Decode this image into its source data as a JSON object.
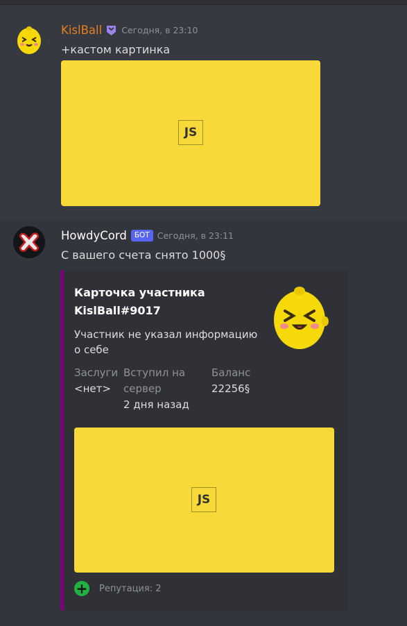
{
  "messages": [
    {
      "author": "KislBall",
      "author_color": "#e67e22",
      "badge_icon": "nitro-badge-icon",
      "timestamp": "Сегодня, в 23:10",
      "text": "+кастом картинка",
      "image": {
        "label": "JS",
        "background": "#f7da3a"
      }
    },
    {
      "author": "HowdyCord",
      "author_color": "#ffffff",
      "bot_tag": "БОТ",
      "timestamp": "Сегодня, в 23:11",
      "text": "С вашего счета снято 1000§",
      "embed": {
        "color": "#800080",
        "title_line1": "Карточка участника",
        "title_line2": "KislBall#9017",
        "description_line1": "Участник не указал информацию",
        "description_line2": "о себе",
        "fields": [
          {
            "name": "Заслуги",
            "value": "<нет>"
          },
          {
            "name_line1": "Вступил на",
            "name_line2": "сервер",
            "value": "2 дня назад"
          },
          {
            "name": "Баланс",
            "value": "22256§"
          }
        ],
        "image": {
          "label": "JS",
          "background": "#f7da3a"
        },
        "footer_icon": "plus-circle-icon",
        "footer_text": "Репутация: 2"
      }
    }
  ]
}
